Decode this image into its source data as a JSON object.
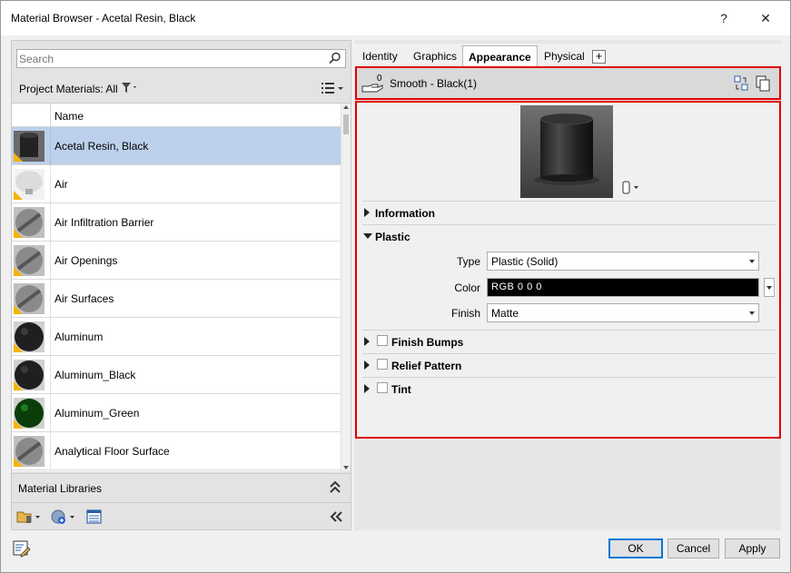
{
  "window": {
    "title": "Material Browser - Acetal Resin, Black",
    "help_label": "?",
    "close_label": "✕"
  },
  "left": {
    "search_placeholder": "Search",
    "project_materials_label": "Project Materials: All",
    "column_name": "Name",
    "materials": [
      {
        "name": "Acetal Resin, Black",
        "selected": true,
        "thumb": "cylinder-black"
      },
      {
        "name": "Air",
        "selected": false,
        "thumb": "air"
      },
      {
        "name": "Air Infiltration Barrier",
        "selected": false,
        "thumb": "sphere-gray-stamp"
      },
      {
        "name": "Air Openings",
        "selected": false,
        "thumb": "sphere-gray-stamp"
      },
      {
        "name": "Air Surfaces",
        "selected": false,
        "thumb": "sphere-gray-stamp"
      },
      {
        "name": "Aluminum",
        "selected": false,
        "thumb": "sphere-black"
      },
      {
        "name": "Aluminum_Black",
        "selected": false,
        "thumb": "sphere-black"
      },
      {
        "name": "Aluminum_Green",
        "selected": false,
        "thumb": "sphere-green"
      },
      {
        "name": "Analytical Floor Surface",
        "selected": false,
        "thumb": "sphere-gray-stamp"
      }
    ],
    "libraries_label": "Material Libraries"
  },
  "right": {
    "tabs": [
      "Identity",
      "Graphics",
      "Appearance",
      "Physical"
    ],
    "active_tab": "Appearance",
    "add_tab_label": "+",
    "asset": {
      "usage_count": "0",
      "name": "Smooth - Black(1)"
    },
    "sections": {
      "information": "Information",
      "plastic": "Plastic",
      "finish_bumps": "Finish Bumps",
      "relief_pattern": "Relief Pattern",
      "tint": "Tint"
    },
    "plastic_props": {
      "type_label": "Type",
      "type_value": "Plastic (Solid)",
      "color_label": "Color",
      "color_value": "RGB 0 0 0",
      "finish_label": "Finish",
      "finish_value": "Matte"
    }
  },
  "footer": {
    "ok_label": "OK",
    "cancel_label": "Cancel",
    "apply_label": "Apply"
  },
  "colors": {
    "selection": "#bcd0ec",
    "highlight_border": "#e00000",
    "default_button_border": "#0078d7"
  }
}
